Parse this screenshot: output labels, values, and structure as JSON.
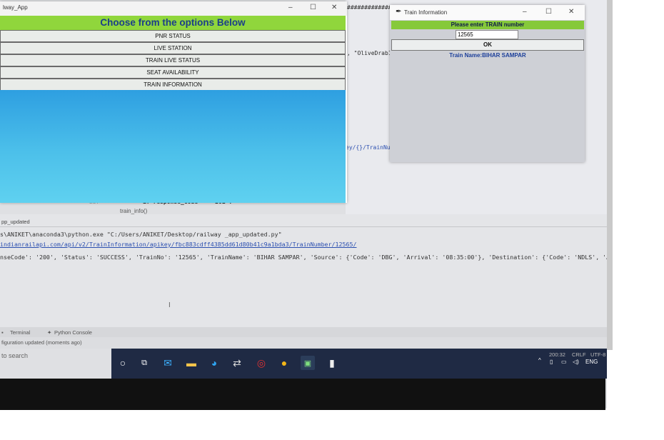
{
  "app_window": {
    "title": "lway_App",
    "header": "Choose from the options Below",
    "options": [
      "PNR STATUS",
      "LIVE STATION",
      "TRAIN LIVE STATUS",
      "SEAT AVAILABILITY",
      "TRAIN INFORMATION"
    ]
  },
  "dialog": {
    "title": "Train Information",
    "prompt": "Please enter TRAIN number",
    "input_value": "12565",
    "ok_label": "OK",
    "result": "Train Name:BIHAR SAMPAR"
  },
  "ide": {
    "code_top": "################",
    "code_olive": ", \"OliveDrab1\"",
    "code_url_frag": "ey/{}/TrainNu",
    "code_line_num": "237",
    "code_if": "if response_code == '201':",
    "code_fn": "train_info()",
    "run_tab": "pp_updated",
    "console": [
      "s\\ANIKET\\anaconda3\\python.exe \"C:/Users/ANIKET/Desktop/railway _app_updated.py\"",
      "indianrailapi.com/api/v2/TrainInformation/apikey/fbc883cdff4385dd61d80b41c9a1bda3/TrainNumber/12565/",
      "nseCode': '200', 'Status': 'SUCCESS', 'TrainNo': '12565', 'TrainName': 'BIHAR SAMPAR', 'Source': {'Code': 'DBG', 'Arrival': '08:35:00'}, 'Destination': {'Code': 'NDLS', 'Arrival'"
    ],
    "tabs": [
      "Terminal",
      "Python Console"
    ],
    "status_msg": "figuration updated (moments ago)",
    "status_right": [
      "200:32",
      "CRLF",
      "UTF-8"
    ]
  },
  "taskbar": {
    "search_placeholder": "to search",
    "lang": "ENG"
  },
  "colors": {
    "header_green": "#90d63c",
    "header_text": "#1b3e8a",
    "body_blue": "#3fb3e8",
    "prompt_green": "#86c93a"
  }
}
